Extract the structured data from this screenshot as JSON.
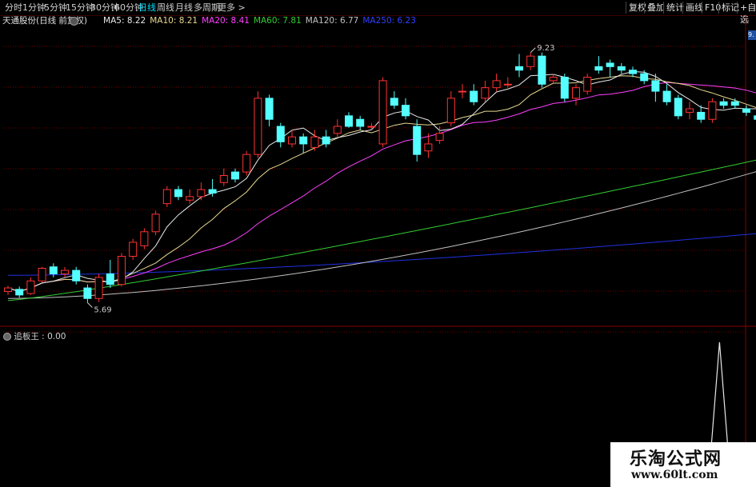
{
  "toolbar": {
    "periods": [
      "分时",
      "1分钟",
      "5分钟",
      "15分钟",
      "30分钟",
      "60分钟",
      "日线",
      "周线",
      "月线",
      "多周期",
      "更多 >"
    ],
    "active_period": "日线",
    "right_buttons": [
      "复权",
      "叠加",
      "统计",
      "画线",
      "F10",
      "标记",
      "+自选"
    ]
  },
  "info": {
    "stock": "天通股份(日线 前复权)",
    "ma5": "MA5: 8.22",
    "ma10": "MA10: 8.21",
    "ma20": "MA20: 8.41",
    "ma60": "MA60: 7.81",
    "ma120": "MA120: 6.77",
    "ma250": "MA250: 6.23"
  },
  "colors": {
    "up": "#ff3232",
    "down": "#54ffff",
    "ma5": "#e8e8e8",
    "ma10": "#e8d890",
    "ma20": "#ff40ff",
    "ma60": "#33cc33",
    "ma120": "#c0c0c0",
    "ma250": "#2030e0",
    "grid": "#6a0000"
  },
  "price_right_tag": "9.",
  "chart_data": {
    "type": "candlestick",
    "high_label": "9.23",
    "low_label": "5.69",
    "ylim": [
      5.4,
      9.6
    ],
    "candles": [
      [
        5.85,
        5.9,
        5.8,
        5.93
      ],
      [
        5.88,
        5.8,
        5.76,
        5.92
      ],
      [
        5.82,
        6.0,
        5.8,
        6.05
      ],
      [
        6.0,
        6.18,
        5.98,
        6.2
      ],
      [
        6.2,
        6.1,
        6.05,
        6.25
      ],
      [
        6.1,
        6.15,
        6.05,
        6.2
      ],
      [
        6.15,
        6.0,
        5.95,
        6.2
      ],
      [
        5.9,
        5.75,
        5.69,
        5.95
      ],
      [
        5.75,
        6.05,
        5.7,
        6.1
      ],
      [
        6.1,
        5.95,
        5.9,
        6.3
      ],
      [
        5.95,
        6.35,
        5.92,
        6.4
      ],
      [
        6.35,
        6.55,
        6.3,
        6.6
      ],
      [
        6.5,
        6.7,
        6.45,
        6.75
      ],
      [
        6.7,
        6.95,
        6.65,
        7.0
      ],
      [
        7.1,
        7.3,
        7.05,
        7.35
      ],
      [
        7.3,
        7.2,
        7.15,
        7.35
      ],
      [
        7.15,
        7.2,
        7.1,
        7.3
      ],
      [
        7.2,
        7.3,
        7.15,
        7.4
      ],
      [
        7.3,
        7.25,
        7.2,
        7.45
      ],
      [
        7.4,
        7.5,
        7.35,
        7.6
      ],
      [
        7.55,
        7.45,
        7.4,
        7.6
      ],
      [
        7.55,
        7.8,
        7.5,
        7.85
      ],
      [
        7.8,
        8.6,
        7.75,
        8.7
      ],
      [
        8.6,
        8.3,
        8.2,
        8.65
      ],
      [
        8.2,
        7.98,
        7.9,
        8.25
      ],
      [
        7.95,
        8.05,
        7.9,
        8.15
      ],
      [
        8.05,
        7.95,
        7.82,
        8.1
      ],
      [
        7.9,
        8.05,
        7.85,
        8.15
      ],
      [
        8.05,
        7.95,
        7.9,
        8.15
      ],
      [
        8.1,
        8.2,
        8.05,
        8.3
      ],
      [
        8.35,
        8.2,
        8.18,
        8.4
      ],
      [
        8.3,
        8.2,
        8.15,
        8.35
      ],
      [
        8.2,
        8.2,
        8.15,
        8.25
      ],
      [
        7.95,
        8.85,
        7.9,
        8.9
      ],
      [
        8.6,
        8.5,
        8.45,
        8.7
      ],
      [
        8.5,
        8.35,
        8.3,
        8.6
      ],
      [
        8.2,
        7.8,
        7.7,
        8.3
      ],
      [
        7.85,
        7.95,
        7.75,
        8.1
      ],
      [
        8.0,
        8.1,
        7.95,
        8.2
      ],
      [
        8.25,
        8.6,
        8.2,
        8.7
      ],
      [
        8.7,
        8.7,
        8.6,
        8.8
      ],
      [
        8.7,
        8.55,
        8.5,
        8.8
      ],
      [
        8.6,
        8.75,
        8.55,
        8.85
      ],
      [
        8.75,
        8.85,
        8.7,
        8.95
      ],
      [
        8.8,
        8.8,
        8.75,
        8.9
      ],
      [
        9.05,
        9.0,
        8.9,
        9.23
      ],
      [
        9.05,
        9.2,
        9.0,
        9.25
      ],
      [
        9.2,
        8.8,
        8.75,
        9.25
      ],
      [
        8.85,
        8.9,
        8.8,
        8.95
      ],
      [
        8.9,
        8.6,
        8.55,
        8.95
      ],
      [
        8.6,
        8.75,
        8.5,
        8.8
      ],
      [
        8.7,
        8.9,
        8.65,
        8.95
      ],
      [
        9.05,
        9.0,
        8.95,
        9.2
      ],
      [
        9.1,
        9.05,
        8.9,
        9.15
      ],
      [
        9.05,
        9.0,
        8.95,
        9.1
      ],
      [
        9.0,
        8.95,
        8.9,
        9.05
      ],
      [
        8.95,
        8.85,
        8.8,
        9.0
      ],
      [
        8.85,
        8.7,
        8.55,
        8.95
      ],
      [
        8.7,
        8.55,
        8.5,
        8.8
      ],
      [
        8.6,
        8.35,
        8.3,
        8.65
      ],
      [
        8.4,
        8.45,
        8.3,
        8.55
      ],
      [
        8.4,
        8.3,
        8.25,
        8.5
      ],
      [
        8.3,
        8.55,
        8.25,
        8.6
      ],
      [
        8.55,
        8.5,
        8.45,
        8.6
      ],
      [
        8.55,
        8.5,
        8.45,
        8.6
      ],
      [
        8.45,
        8.4,
        8.35,
        8.5
      ],
      [
        8.35,
        8.3,
        8.2,
        8.4
      ],
      [
        8.5,
        8.6,
        8.45,
        8.7
      ],
      [
        8.6,
        8.55,
        8.5,
        8.65
      ],
      [
        8.6,
        8.5,
        8.45,
        8.95
      ],
      [
        8.75,
        8.7,
        8.6,
        8.85
      ],
      [
        8.65,
        8.4,
        8.3,
        8.7
      ],
      [
        8.3,
        7.95,
        7.9,
        8.3
      ],
      [
        8.0,
        8.05,
        7.95,
        8.15
      ]
    ],
    "indicator": {
      "name": "追板王",
      "value": "0.00",
      "spike_index": 62
    }
  },
  "watermark": {
    "title": "乐淘公式网",
    "url": "www.60lt.com"
  }
}
